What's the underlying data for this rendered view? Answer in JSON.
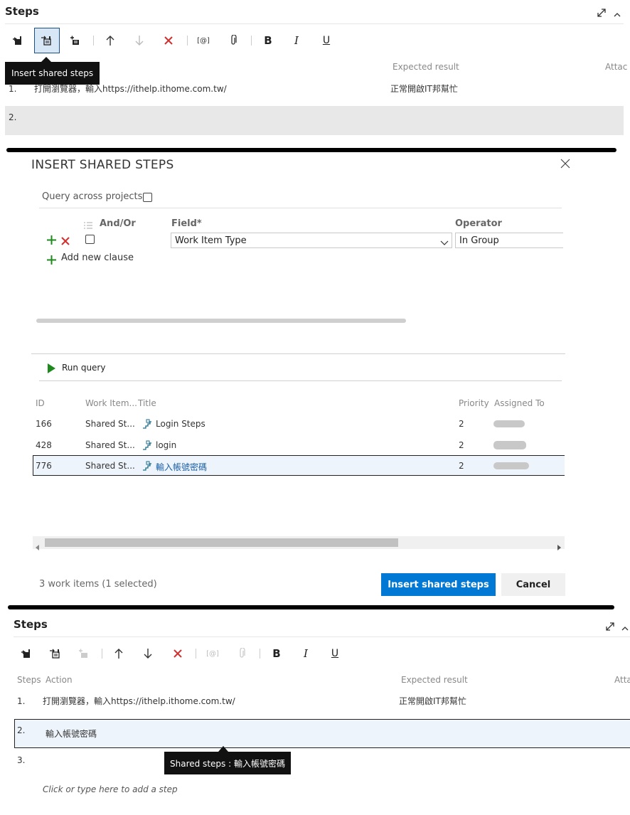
{
  "top": {
    "title": "Steps",
    "tooltip": "Insert shared steps",
    "col_expected": "Expected result",
    "col_attach": "Attac",
    "steps": [
      {
        "num": "1.",
        "action": "打開瀏覽器，輸入https://ithelp.ithome.com.tw/",
        "expected": "正常開啟IT邦幫忙"
      },
      {
        "num": "2.",
        "action": "",
        "expected": ""
      }
    ]
  },
  "dialog": {
    "title": "INSERT SHARED STEPS",
    "query_across": "Query across projects",
    "and_or": "And/Or",
    "field_header": "Field*",
    "operator_header": "Operator",
    "field_value": "Work Item Type",
    "operator_value": "In Group",
    "add_clause": "Add new clause",
    "run_query": "Run query",
    "columns": {
      "id": "ID",
      "type": "Work Item...",
      "title": "Title",
      "priority": "Priority",
      "assigned": "Assigned To"
    },
    "rows": [
      {
        "id": "166",
        "type": "Shared St...",
        "title": "Login Steps",
        "priority": "2"
      },
      {
        "id": "428",
        "type": "Shared St...",
        "title": "login",
        "priority": "2"
      },
      {
        "id": "776",
        "type": "Shared St...",
        "title": "輸入帳號密碼",
        "priority": "2"
      }
    ],
    "status": "3 work items (1 selected)",
    "insert_button": "Insert shared steps",
    "cancel_button": "Cancel"
  },
  "bottom": {
    "title": "Steps",
    "col_steps": "Steps",
    "col_action": "Action",
    "col_expected": "Expected result",
    "col_attach": "Atta",
    "steps": [
      {
        "num": "1.",
        "action": "打開瀏覽器，輸入https://ithelp.ithome.com.tw/",
        "expected": "正常開啟IT邦幫忙"
      },
      {
        "num": "2.",
        "action": "輸入帳號密碼",
        "expected": ""
      },
      {
        "num": "3.",
        "action": "",
        "expected": ""
      }
    ],
    "tooltip": "Shared steps : 輸入帳號密碼",
    "placeholder": "Click or type here to add a step"
  },
  "toolbar": {
    "bold": "B",
    "italic": "I",
    "underline": "U",
    "param": "[@]"
  },
  "colors": {
    "accent": "#0078d4",
    "delete": "#d32f2f",
    "add": "#1e8a1e",
    "link": "#1a5fa3"
  }
}
